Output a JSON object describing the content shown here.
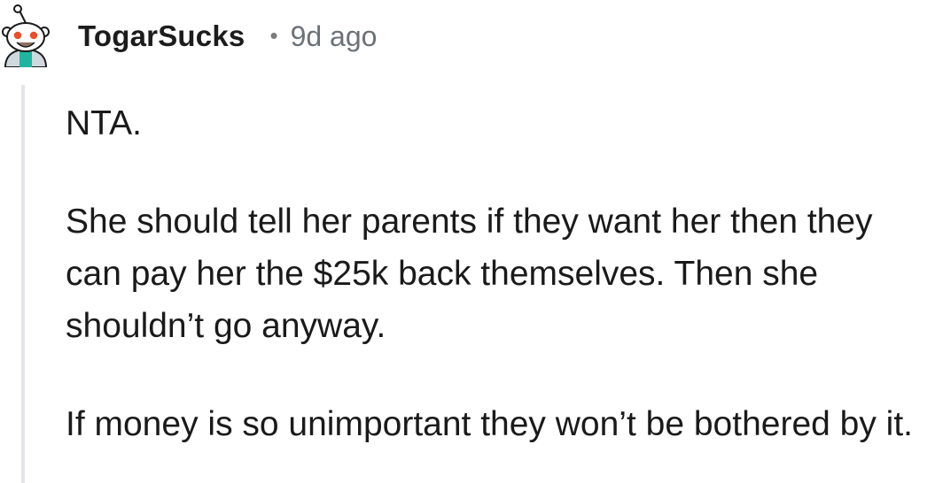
{
  "comment": {
    "username": "TogarSucks",
    "separator": "•",
    "timestamp": "9d ago",
    "avatar_icon": "snoo-avatar-icon",
    "paragraphs": [
      "NTA.",
      "She should tell her parents if they want her then they can pay her the $25k back themselves. Then she shouldn’t go anyway.",
      "If money is so unimportant they won’t be bothered by it."
    ]
  },
  "colors": {
    "avatar_face": "#ffffff",
    "avatar_eyes": "#e8502a",
    "avatar_shirt": "#1fb5a0",
    "avatar_outline": "#1a1a1b",
    "thread_line": "#e3e5e8"
  }
}
